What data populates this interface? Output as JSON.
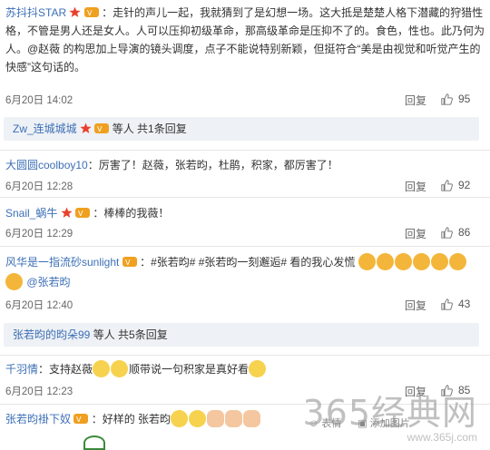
{
  "comments": [
    {
      "user": "苏抖抖STAR",
      "text": "：走针的声儿一起，我就猜到了是幻想一场。这大抵是楚楚人格下潜藏的狩猎性格，不管是男人还是女人。人可以压抑初级革命，那高级革命是压抑不了的。食色，性也。此乃何为人。@赵薇 的构思加上导演的镜头调度，点子不能说特别新颖，但挺符合“美是由视觉和听觉产生的快感”这句话的。",
      "time": "6月20日 14:02",
      "reply": "回复",
      "likes": "95"
    },
    {
      "user": "大圆圆coolboy10",
      "text": "：厉害了！赵薇，张若昀，杜鹃，积家，都厉害了！",
      "time": "6月20日 12:28",
      "reply": "回复",
      "likes": "92"
    },
    {
      "user": "Snail_蜗牛",
      "text": "：棒棒的我薇！",
      "time": "6月20日 12:29",
      "reply": "回复",
      "likes": "86"
    },
    {
      "user": "风华是一指流砂sunlight",
      "text": "：#张若昀# #张若昀一刻邂逅# 看的我心发慌",
      "mention": "@张若昀",
      "time": "6月20日 12:40",
      "reply": "回复",
      "likes": "43"
    },
    {
      "user": "千羽情",
      "text": "：支持赵薇",
      "text2": "顺带说一句积家是真好看",
      "time": "6月20日 12:23",
      "reply": "回复",
      "likes": "85"
    },
    {
      "user": "张若昀褂下奴",
      "text": "：好样的 张若昀"
    }
  ],
  "subthreads": [
    {
      "user": "Zw_连城城城",
      "text": "等人 共1条回复"
    },
    {
      "user": "张若昀的昀朵99",
      "text": "等人 共5条回复"
    }
  ],
  "input": {
    "emoji": "表情",
    "image": "添加图片"
  },
  "watermark": {
    "big": "365经典网",
    "small": "www.365j.com"
  },
  "colors": {
    "link": "#3c6fb6",
    "star": "#e8412e",
    "subbg": "#eef1f5"
  }
}
